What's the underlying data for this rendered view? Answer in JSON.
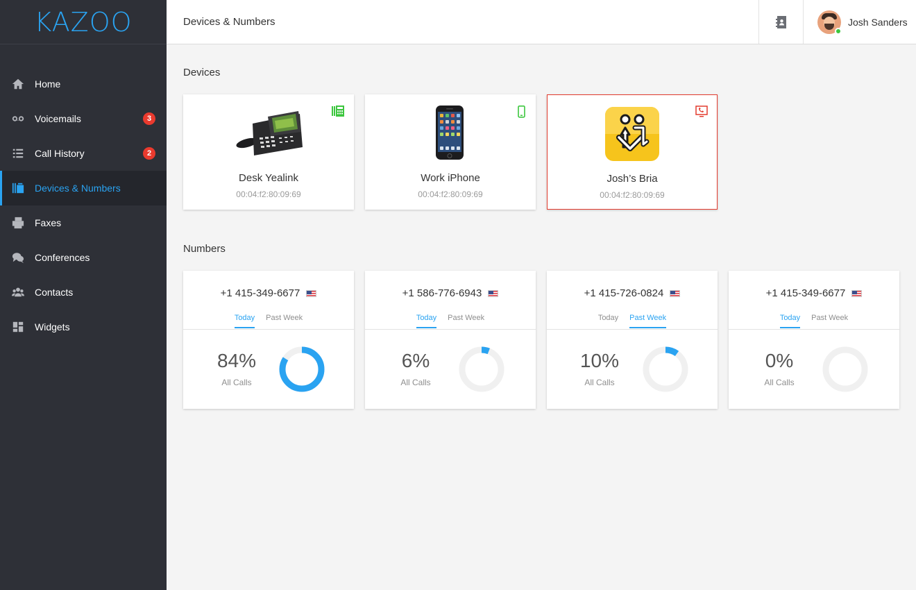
{
  "app": {
    "logo": "KAZOO"
  },
  "sidebar": {
    "items": [
      {
        "label": "Home",
        "icon": "home-icon"
      },
      {
        "label": "Voicemails",
        "icon": "voicemail-icon",
        "badge": "3"
      },
      {
        "label": "Call History",
        "icon": "list-icon",
        "badge": "2"
      },
      {
        "label": "Devices & Numbers",
        "icon": "devices-icon",
        "active": true
      },
      {
        "label": "Faxes",
        "icon": "fax-icon"
      },
      {
        "label": "Conferences",
        "icon": "conference-icon"
      },
      {
        "label": "Contacts",
        "icon": "contacts-icon"
      },
      {
        "label": "Widgets",
        "icon": "widgets-icon"
      }
    ]
  },
  "header": {
    "title": "Devices & Numbers",
    "contacts_icon": "address-book-icon",
    "user": {
      "name": "Josh Sanders",
      "status": "online"
    }
  },
  "devices": {
    "title": "Devices",
    "items": [
      {
        "name": "Desk Yealink",
        "mac": "00:04:f2:80:09:69",
        "type": "desk-phone",
        "type_icon": "desk-phone-icon",
        "icon_color": "#3cc63e"
      },
      {
        "name": "Work iPhone",
        "mac": "00:04:f2:80:09:69",
        "type": "mobile",
        "type_icon": "mobile-phone-icon",
        "icon_color": "#3cc63e"
      },
      {
        "name": "Josh’s Bria",
        "mac": "00:04:f2:80:09:69",
        "type": "softphone",
        "type_icon": "softphone-icon",
        "icon_color": "#e33b2e",
        "selected": true
      }
    ]
  },
  "numbers": {
    "title": "Numbers",
    "items": [
      {
        "number": "+1 415-349-6677",
        "tabs": [
          "Today",
          "Past Week"
        ],
        "active_tab": 0,
        "percent": "84%",
        "value": 0.84,
        "label": "All Calls"
      },
      {
        "number": "+1 586-776-6943",
        "tabs": [
          "Today",
          "Past Week"
        ],
        "active_tab": 0,
        "percent": "6%",
        "value": 0.06,
        "label": "All Calls"
      },
      {
        "number": "+1 415-726-0824",
        "tabs": [
          "Today",
          "Past Week"
        ],
        "active_tab": 1,
        "percent": "10%",
        "value": 0.1,
        "label": "All Calls"
      },
      {
        "number": "+1 415-349-6677",
        "tabs": [
          "Today",
          "Past Week"
        ],
        "active_tab": 0,
        "percent": "0%",
        "value": 0.0,
        "label": "All Calls"
      }
    ]
  },
  "colors": {
    "accent": "#2aa3f1",
    "sidebar": "#2e3037",
    "badge": "#ea3a2e",
    "track": "#f0f0f0"
  }
}
